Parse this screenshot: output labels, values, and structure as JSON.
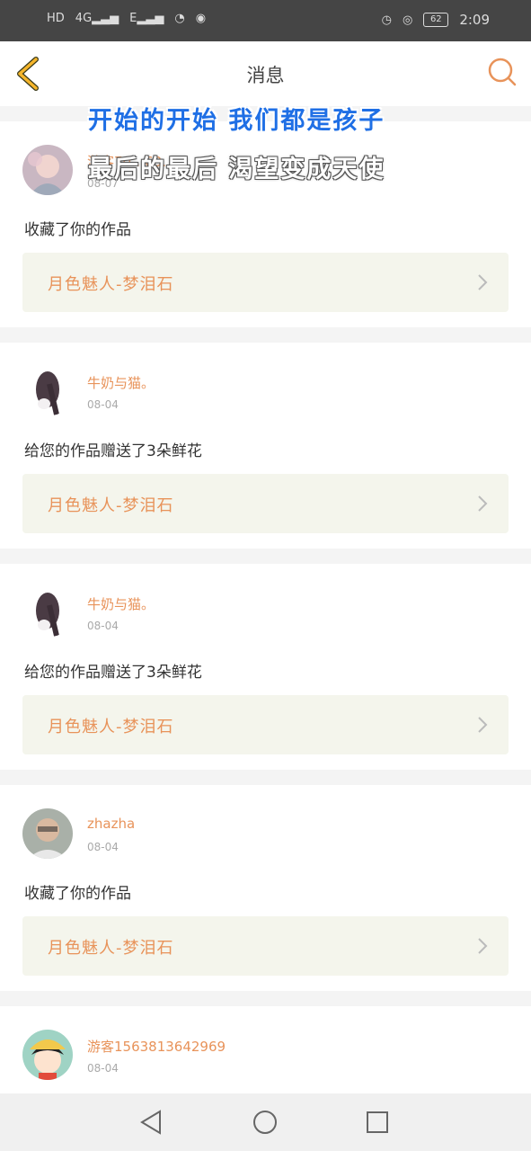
{
  "status_bar": {
    "network_left": "HD",
    "signal1": "4G",
    "signal2": "E",
    "battery": "62",
    "time": "2:09"
  },
  "header": {
    "title": "消息"
  },
  "overlay": {
    "line1": "开始的开始 我们都是孩子",
    "line2": "最后的最后 渴望变成天使"
  },
  "messages": [
    {
      "username": "游客70…63…9",
      "date": "08-07",
      "action": "收藏了你的作品",
      "work": "月色魅人-梦泪石"
    },
    {
      "username": "牛奶与猫。",
      "date": "08-04",
      "action": "给您的作品赠送了3朵鲜花",
      "work": "月色魅人-梦泪石"
    },
    {
      "username": "牛奶与猫。",
      "date": "08-04",
      "action": "给您的作品赠送了3朵鲜花",
      "work": "月色魅人-梦泪石"
    },
    {
      "username": "zhazha",
      "date": "08-04",
      "action": "收藏了你的作品",
      "work": "月色魅人-梦泪石"
    },
    {
      "username": "游客1563813642969",
      "date": "08-04",
      "action": "",
      "work": ""
    }
  ],
  "colors": {
    "accent": "#e8935a",
    "back_icon": "#f5b52b",
    "lyric_blue": "#1f6fe5"
  }
}
